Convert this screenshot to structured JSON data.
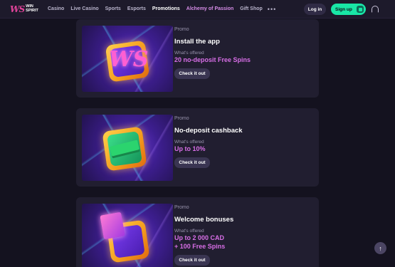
{
  "header": {
    "logo_mark": "WS",
    "logo_line1": "WIN",
    "logo_line2": "SPIRIT",
    "nav": [
      "Casino",
      "Live Casino",
      "Sports",
      "Esports",
      "Promotions",
      "Alchemy of Passion",
      "Gift Shop"
    ],
    "more": "•••",
    "login": "Log in",
    "signup": "Sign up"
  },
  "colors": {
    "background": "#14121f",
    "card": "#211e30",
    "accent_green": "#19e6a6",
    "accent_pink": "#d76ee6"
  },
  "promos": [
    {
      "label": "Promo",
      "title": "Install the app",
      "offer_label": "What's offered",
      "offer_line1": "20 no-deposit Free Spins",
      "offer_line2": "",
      "cta": "Check it out",
      "image": "ws-logo-tile"
    },
    {
      "label": "Promo",
      "title": "No-deposit cashback",
      "offer_label": "What's offered",
      "offer_line1": "Up to 10%",
      "offer_line2": "",
      "cta": "Check it out",
      "image": "cashback-money-tile"
    },
    {
      "label": "Promo",
      "title": "Welcome bonuses",
      "offer_label": "What's offered",
      "offer_line1": "Up to 2 000 CAD",
      "offer_line2": "+ 100 Free Spins",
      "cta": "Check it out",
      "image": "gift-box-tile"
    }
  ],
  "scroll_top_icon": "arrow-up-icon"
}
